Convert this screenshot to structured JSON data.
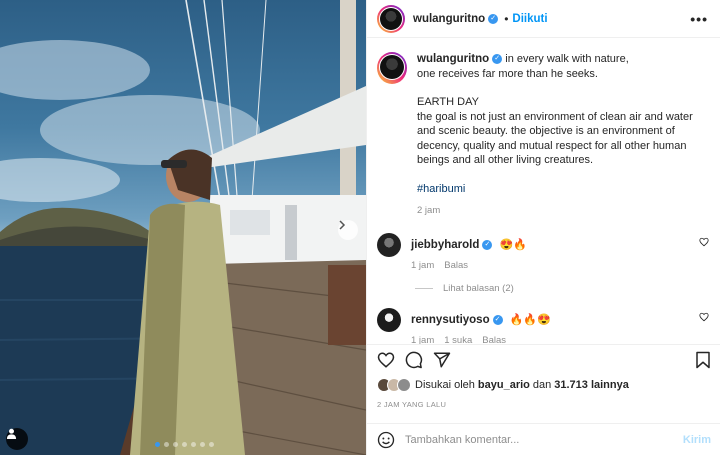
{
  "post": {
    "author": "wulanguritno",
    "follow_status": "Diikuti",
    "more_label": "•••",
    "caption_first": "in every walk with nature,",
    "caption_second": "one receives far more than he seeks.",
    "caption_heading": "EARTH DAY",
    "caption_body": "the goal is not just an environment of clean air and water and scenic beauty. the objective is an environment of decency, quality and mutual respect for all other human beings and all other living creatures.",
    "hashtag": "#haribumi",
    "caption_time": "2 jam"
  },
  "comments": [
    {
      "user": "jiebbyharold",
      "text": "😍🔥",
      "time": "1 jam",
      "reply_label": "Balas",
      "view_replies": "Lihat balasan (2)"
    },
    {
      "user": "rennysutiyoso",
      "text": "🔥🔥😍",
      "time": "1 jam",
      "likes": "1 suka",
      "reply_label": "Balas"
    }
  ],
  "likes": {
    "prefix": "Disukai oleh",
    "user": "bayu_ario",
    "joiner": "dan",
    "others": "31.713 lainnya"
  },
  "timestamp": "2 JAM YANG LALU",
  "comment_input": {
    "placeholder": "Tambahkan komentar...",
    "post_label": "Kirim"
  },
  "carousel": {
    "count": 7,
    "active_index": 0
  },
  "icons": {
    "heart": "heart-icon",
    "comment": "comment-icon",
    "share": "share-icon",
    "bookmark": "bookmark-icon",
    "emoji": "emoji-icon",
    "user_tag": "user-tag-icon",
    "next": "chevron-right-icon"
  },
  "colors": {
    "accent": "#0095f6",
    "verified": "#3897f0",
    "muted": "#8e8e8e",
    "post_disabled": "#b2dffc"
  }
}
